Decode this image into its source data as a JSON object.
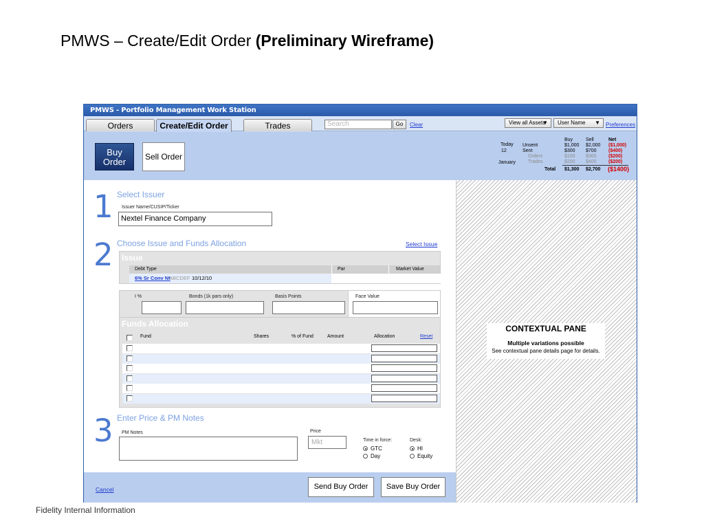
{
  "slide": {
    "title": "PMWS – Create/Edit Order",
    "title_bold": "(Preliminary Wireframe)",
    "footer": "Fidelity Internal Information"
  },
  "window": {
    "title": "PMWS - Portfolio Management Work Station"
  },
  "tabs": [
    {
      "label": "Orders"
    },
    {
      "label": "Create/Edit Order",
      "active": true
    },
    {
      "label": "Trades"
    }
  ],
  "search": {
    "placeholder": "Search",
    "go_label": "Go",
    "clear_label": "Clear"
  },
  "header_right": {
    "assets_dropdown": "View all Assets",
    "user_dropdown": "User Name",
    "preferences_label": "Preferences"
  },
  "actions": {
    "buy_label": "Buy Order",
    "buy_line1": "Buy",
    "buy_line2": "Order",
    "sell_label": "Sell Order"
  },
  "summary": {
    "today_label": "Today",
    "day": "12",
    "month": "January",
    "col_buy": "Buy",
    "col_sell": "Sell",
    "col_net": "Net",
    "rows": [
      {
        "label": "Unsent",
        "buy": "$1,000",
        "sell": "$2,000",
        "net": "($1,000)"
      },
      {
        "label": "Sent",
        "buy": "$300",
        "sell": "$700",
        "net": "($400)"
      },
      {
        "label": "Orders",
        "buy": "$100",
        "sell": "$300",
        "net": "($200)"
      },
      {
        "label": "Trades",
        "buy": "$200",
        "sell": "$400",
        "net": "($200)"
      }
    ],
    "total_label": "Total",
    "total_buy": "$1,300",
    "total_sell": "$2,700",
    "total_net": "($1400)"
  },
  "step1": {
    "number": "1",
    "heading": "Select Issuer",
    "field_label": "Issuer Name/CUSIP/Ticker",
    "field_value": "Nextel Finance Company"
  },
  "step2": {
    "number": "2",
    "heading": "Choose Issue and Funds Allocation",
    "select_issue_link": "Select Issue",
    "issue_panel_title": "Issue",
    "issue_columns": [
      "Debt Type",
      "Par",
      "Market Value"
    ],
    "issue_link": "6% Sr Conv Nt",
    "issue_code": "ABCDEF",
    "issue_date": "10/12/10",
    "input_labels": {
      "i_pct": "I %",
      "bonds": "Bonds (1k pars only)",
      "basis_points": "Basis Points",
      "face_value": "Face Value"
    },
    "funds_panel_title": "Funds Allocation",
    "funds_columns": [
      "Fund",
      "Shares",
      "% of Fund",
      "Amount",
      "Allocation"
    ],
    "reset_label": "Reset",
    "fund_row_count_visible": 6
  },
  "step3": {
    "number": "3",
    "heading": "Enter Price & PM Notes",
    "notes_label": "PM Notes",
    "price_label": "Price",
    "price_placeholder": "Mkt",
    "tif_label": "Time in force:",
    "tif_options": [
      "GTC",
      "Day"
    ],
    "desk_label": "Desk:",
    "desk_options": [
      "HI",
      "Equity"
    ]
  },
  "bottom": {
    "cancel_label": "Cancel",
    "send_label": "Send Buy Order",
    "save_label": "Save Buy Order"
  },
  "context_pane": {
    "title": "CONTEXTUAL PANE",
    "subtitle": "Multiple variations possible",
    "detail": "See contextual pane details page for details."
  }
}
